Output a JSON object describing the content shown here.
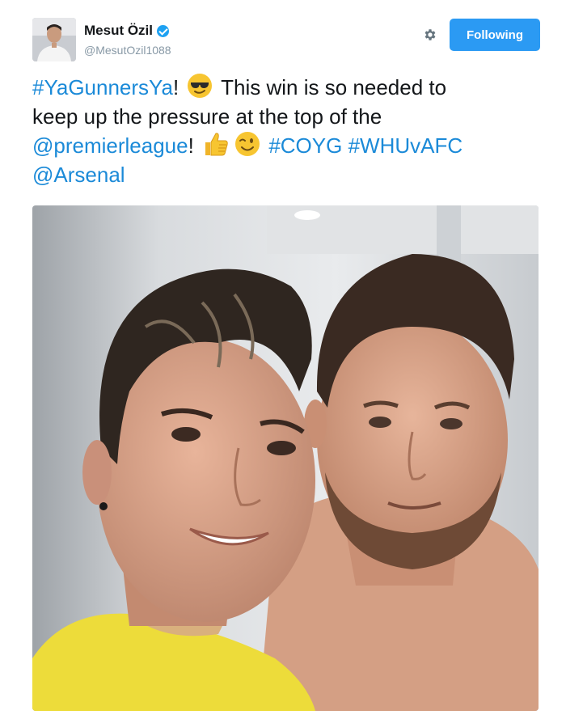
{
  "header": {
    "display_name": "Mesut Özil",
    "handle": "@MesutOzil1088",
    "follow_button_label": "Following"
  },
  "tweet": {
    "hashtag_yagunners": "#YaGunnersYa",
    "exclaim": "!",
    "text_part1": " This win is so needed to",
    "line2": "keep up the pressure at the top of the",
    "mention_premierleague": "@premierleague",
    "exclaim2": "!",
    "hashtag_coyg": "#COYG",
    "hashtag_whuvafc": "#WHUvAFC",
    "mention_arsenal": "@Arsenal"
  },
  "icons": {
    "verified": "verified-badge-icon",
    "settings": "gear-icon",
    "emoji_1": "sunglasses-face-emoji",
    "emoji_2": "thumbs-up-emoji",
    "emoji_3": "winking-face-emoji"
  },
  "colors": {
    "link": "#1b8ad8",
    "follow_button": "#2b9af3",
    "verified": "#1da1f2",
    "handle": "#8899a6"
  }
}
